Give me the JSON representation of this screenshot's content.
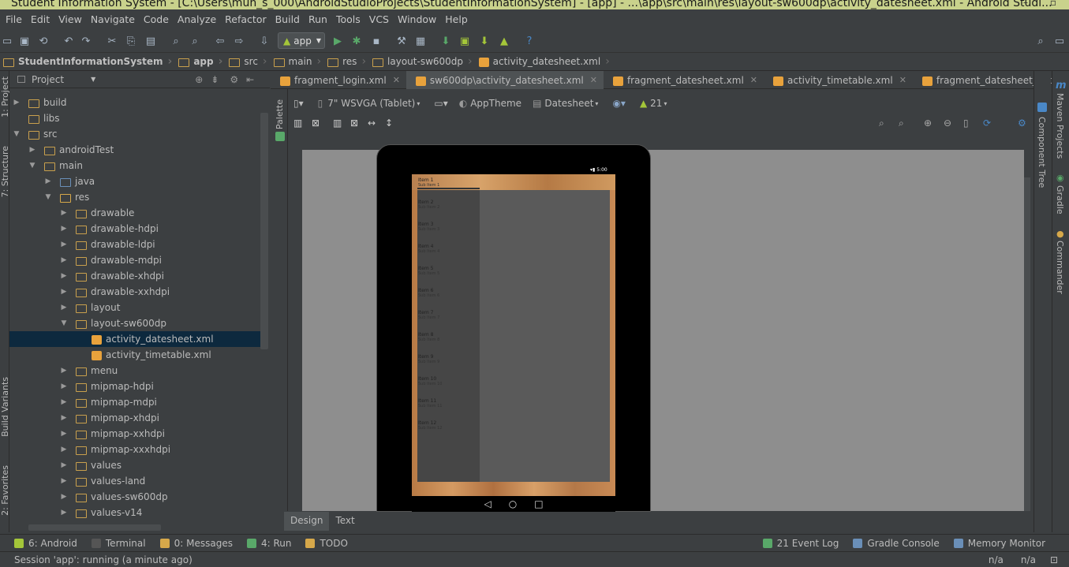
{
  "window": {
    "title": "Student Information System - [C:\\Users\\muh_s_000\\AndroidStudioProjects\\StudentInformationSystem] - [app] - ...\\app\\src\\main\\res\\layout-sw600dp\\activity_datesheet.xml - Android Studi..."
  },
  "menu": [
    "File",
    "Edit",
    "View",
    "Navigate",
    "Code",
    "Analyze",
    "Refactor",
    "Build",
    "Run",
    "Tools",
    "VCS",
    "Window",
    "Help"
  ],
  "toolbar": {
    "run_config": "app"
  },
  "breadcrumb": [
    "StudentInformationSystem",
    "app",
    "src",
    "main",
    "res",
    "layout-sw600dp",
    "activity_datesheet.xml"
  ],
  "left_strip": {
    "project": "1: Project",
    "structure": "7: Structure",
    "build_variants": "Build Variants",
    "favorites": "2: Favorites"
  },
  "project_panel": {
    "header": "Project",
    "tree": [
      {
        "label": "build",
        "type": "folder",
        "expanded": false,
        "level": 0
      },
      {
        "label": "libs",
        "type": "folder",
        "expanded": null,
        "level": 0
      },
      {
        "label": "src",
        "type": "folder",
        "expanded": true,
        "level": 0
      },
      {
        "label": "androidTest",
        "type": "folder",
        "expanded": false,
        "level": 1
      },
      {
        "label": "main",
        "type": "folder",
        "expanded": true,
        "level": 1
      },
      {
        "label": "java",
        "type": "folder",
        "expanded": false,
        "level": 2
      },
      {
        "label": "res",
        "type": "folder",
        "expanded": true,
        "level": 2
      },
      {
        "label": "drawable",
        "type": "folder",
        "expanded": false,
        "level": 3
      },
      {
        "label": "drawable-hdpi",
        "type": "folder",
        "expanded": false,
        "level": 3
      },
      {
        "label": "drawable-ldpi",
        "type": "folder",
        "expanded": false,
        "level": 3
      },
      {
        "label": "drawable-mdpi",
        "type": "folder",
        "expanded": false,
        "level": 3
      },
      {
        "label": "drawable-xhdpi",
        "type": "folder",
        "expanded": false,
        "level": 3
      },
      {
        "label": "drawable-xxhdpi",
        "type": "folder",
        "expanded": false,
        "level": 3
      },
      {
        "label": "layout",
        "type": "folder",
        "expanded": false,
        "level": 3
      },
      {
        "label": "layout-sw600dp",
        "type": "folder",
        "expanded": true,
        "level": 3
      },
      {
        "label": "activity_datesheet.xml",
        "type": "xml",
        "expanded": null,
        "level": 4,
        "selected": true
      },
      {
        "label": "activity_timetable.xml",
        "type": "xml",
        "expanded": null,
        "level": 4
      },
      {
        "label": "menu",
        "type": "folder",
        "expanded": false,
        "level": 3
      },
      {
        "label": "mipmap-hdpi",
        "type": "folder",
        "expanded": false,
        "level": 3
      },
      {
        "label": "mipmap-mdpi",
        "type": "folder",
        "expanded": false,
        "level": 3
      },
      {
        "label": "mipmap-xhdpi",
        "type": "folder",
        "expanded": false,
        "level": 3
      },
      {
        "label": "mipmap-xxhdpi",
        "type": "folder",
        "expanded": false,
        "level": 3
      },
      {
        "label": "mipmap-xxxhdpi",
        "type": "folder",
        "expanded": false,
        "level": 3
      },
      {
        "label": "values",
        "type": "folder",
        "expanded": false,
        "level": 3
      },
      {
        "label": "values-land",
        "type": "folder",
        "expanded": false,
        "level": 3
      },
      {
        "label": "values-sw600dp",
        "type": "folder",
        "expanded": false,
        "level": 3
      },
      {
        "label": "values-v14",
        "type": "folder",
        "expanded": false,
        "level": 3
      }
    ]
  },
  "editor_tabs": [
    {
      "label": "fragment_login.xml",
      "active": false
    },
    {
      "label": "sw600dp\\activity_datesheet.xml",
      "active": true
    },
    {
      "label": "fragment_datesheet.xml",
      "active": false
    },
    {
      "label": "activity_timetable.xml",
      "active": false
    },
    {
      "label": "fragment_datesheet_detail.xml",
      "active": false
    }
  ],
  "palette_label": "Palette",
  "design_toolbar": {
    "device": "7\" WSVGA (Tablet)",
    "theme": "AppTheme",
    "activity": "Datesheet",
    "api": "21"
  },
  "preview": {
    "status_time": "5:00",
    "items": [
      {
        "title": "Item 1",
        "sub": "Sub Item 1"
      },
      {
        "title": "Item 2",
        "sub": "Sub Item 2"
      },
      {
        "title": "Item 3",
        "sub": "Sub Item 3"
      },
      {
        "title": "Item 4",
        "sub": "Sub Item 4"
      },
      {
        "title": "Item 5",
        "sub": "Sub Item 5"
      },
      {
        "title": "Item 6",
        "sub": "Sub Item 6"
      },
      {
        "title": "Item 7",
        "sub": "Sub Item 7"
      },
      {
        "title": "Item 8",
        "sub": "Sub Item 8"
      },
      {
        "title": "Item 9",
        "sub": "Sub Item 9"
      },
      {
        "title": "Item 10",
        "sub": "Sub Item 10"
      },
      {
        "title": "Item 11",
        "sub": "Sub Item 11"
      },
      {
        "title": "Item 12",
        "sub": "Sub Item 12"
      }
    ]
  },
  "bottom_editor_tabs": [
    {
      "label": "Design",
      "active": true
    },
    {
      "label": "Text",
      "active": false
    }
  ],
  "right_strip": {
    "maven": "Maven Projects",
    "component_tree": "Component Tree",
    "gradle": "Gradle",
    "commander": "Commander"
  },
  "tool_windows": [
    {
      "label": "6: Android",
      "color": "#a4c639"
    },
    {
      "label": "Terminal",
      "color": "#555555"
    },
    {
      "label": "0: Messages",
      "color": "#d6a84a"
    },
    {
      "label": "4: Run",
      "color": "#59a869"
    },
    {
      "label": "TODO",
      "color": "#d6a84a"
    }
  ],
  "tool_windows_right": [
    {
      "label": "21  Event Log",
      "color": "#59a869"
    },
    {
      "label": "Gradle Console",
      "color": "#6a8fb8"
    },
    {
      "label": "Memory Monitor",
      "color": "#6a8fb8"
    }
  ],
  "status": {
    "message": "Session 'app': running (a minute ago)",
    "na1": "n/a",
    "na2": "n/a"
  }
}
